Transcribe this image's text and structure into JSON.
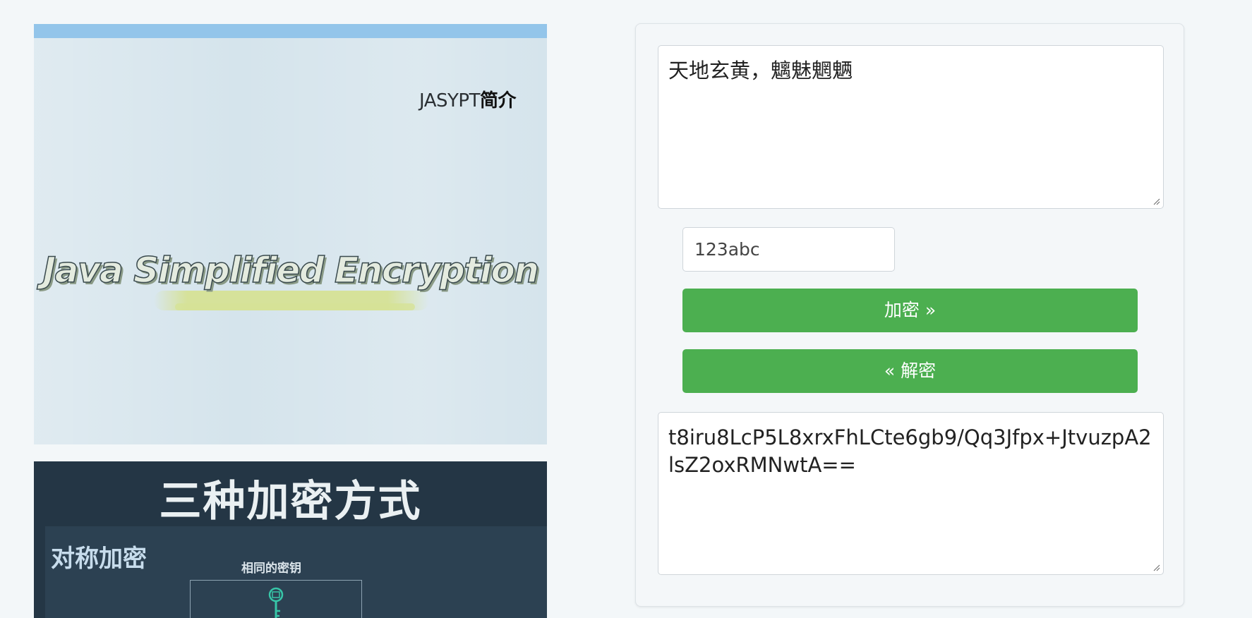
{
  "hero": {
    "brand_light": "JASYPT",
    "brand_bold": "简介",
    "title": "Java Simplified Encryption"
  },
  "slide": {
    "title": "三种加密方式",
    "section": "对称加密",
    "key_label": "相同的密钥"
  },
  "form": {
    "input_text": "天地玄黄，魑魅魍魉",
    "password_value": "123abc",
    "encrypt_label": "加密 »",
    "decrypt_label": "« 解密",
    "output_text": "t8iru8LcP5L8xrxFhLCte6gb9/Qq3Jfpx+JtvuzpA2lsZ2oxRMNwtA=="
  },
  "colors": {
    "button": "#4caf50",
    "hero_bar": "#93c5ea",
    "slide_bg": "#243645"
  }
}
